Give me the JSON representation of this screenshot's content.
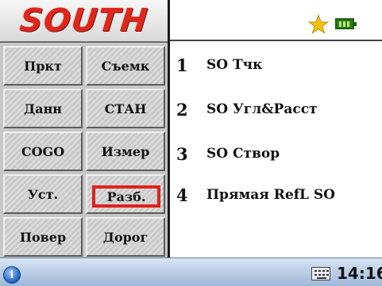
{
  "logo": {
    "text": "SOUTH"
  },
  "menu": {
    "buttons": [
      {
        "label": "Пркт"
      },
      {
        "label": "Съемк"
      },
      {
        "label": "Данн"
      },
      {
        "label": "СТАН"
      },
      {
        "label": "COGO"
      },
      {
        "label": "Измер"
      },
      {
        "label": "Уст."
      },
      {
        "label": "Разб."
      },
      {
        "label": "Повер"
      },
      {
        "label": "Дорог"
      }
    ],
    "selected": "Разб."
  },
  "status": {
    "star_icon": "star-icon",
    "battery_icon": "battery-icon",
    "accent_color": "#e2211a",
    "star_color": "#f2c20a"
  },
  "functions": [
    {
      "num": "1",
      "label": "SO Тчк"
    },
    {
      "num": "2",
      "label": "SO Угл&Расст"
    },
    {
      "num": "3",
      "label": "SO Створ"
    },
    {
      "num": "4",
      "label": "Прямая RefL SO"
    }
  ],
  "taskbar": {
    "start_icon": "start-icon",
    "keyboard_icon": "keyboard-icon",
    "time": "14:16"
  }
}
